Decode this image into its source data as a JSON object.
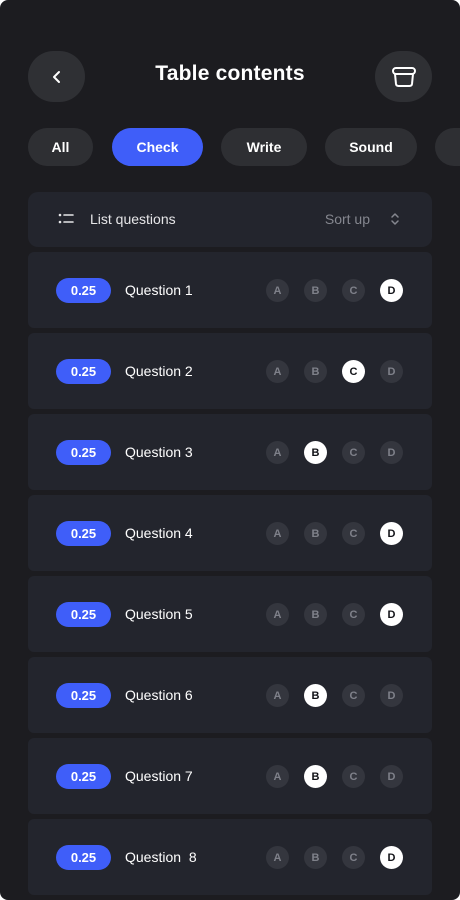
{
  "header": {
    "title": "Table contents",
    "back_icon": "chevron-left-icon",
    "action_icon": "basket-icon"
  },
  "tabs": [
    {
      "label": "All",
      "active": false
    },
    {
      "label": "Check",
      "active": true
    },
    {
      "label": "Write",
      "active": false
    },
    {
      "label": "Sound",
      "active": false
    },
    {
      "label": "",
      "active": false
    }
  ],
  "list_header": {
    "label": "List questions",
    "sort_label": "Sort up",
    "list_icon": "list-icon",
    "sort_icon": "sort-icon"
  },
  "questions": [
    {
      "score": "0.25",
      "label": "Question 1",
      "options": [
        "A",
        "B",
        "C",
        "D"
      ],
      "selected": "D"
    },
    {
      "score": "0.25",
      "label": "Question 2",
      "options": [
        "A",
        "B",
        "C",
        "D"
      ],
      "selected": "C"
    },
    {
      "score": "0.25",
      "label": "Question 3",
      "options": [
        "A",
        "B",
        "C",
        "D"
      ],
      "selected": "B"
    },
    {
      "score": "0.25",
      "label": "Question 4",
      "options": [
        "A",
        "B",
        "C",
        "D"
      ],
      "selected": "D"
    },
    {
      "score": "0.25",
      "label": "Question 5",
      "options": [
        "A",
        "B",
        "C",
        "D"
      ],
      "selected": "D"
    },
    {
      "score": "0.25",
      "label": "Question 6",
      "options": [
        "A",
        "B",
        "C",
        "D"
      ],
      "selected": "B"
    },
    {
      "score": "0.25",
      "label": "Question 7",
      "options": [
        "A",
        "B",
        "C",
        "D"
      ],
      "selected": "B"
    },
    {
      "score": "0.25",
      "label": "Question  8",
      "options": [
        "A",
        "B",
        "C",
        "D"
      ],
      "selected": "D"
    }
  ],
  "colors": {
    "background": "#1c1c20",
    "card": "#23252d",
    "accent": "#3f5ef9",
    "selected_option": "#ffffff"
  }
}
